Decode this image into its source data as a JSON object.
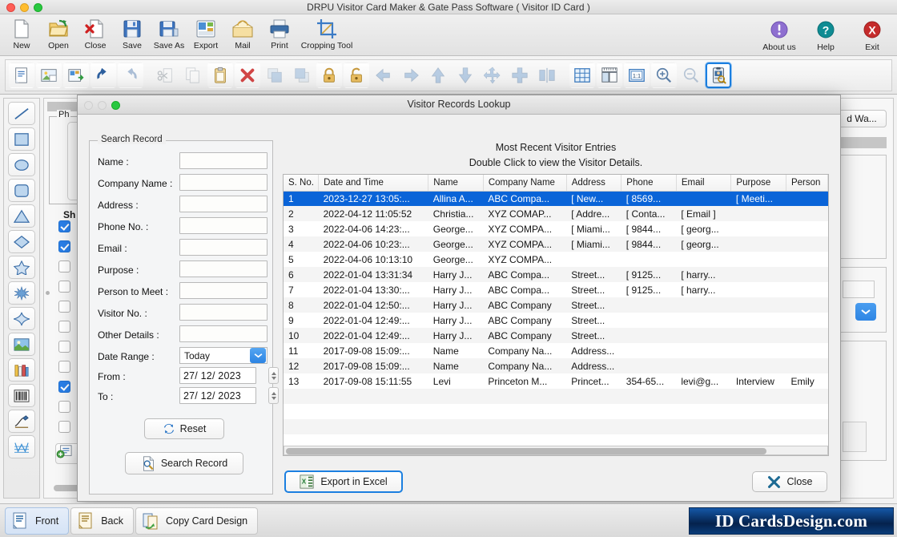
{
  "window": {
    "title": "DRPU Visitor Card Maker & Gate Pass Software ( Visitor ID Card )"
  },
  "toolbar_main": {
    "items": [
      {
        "label": "New",
        "icon": "new-document-icon"
      },
      {
        "label": "Open",
        "icon": "open-folder-icon"
      },
      {
        "label": "Close",
        "icon": "close-document-icon"
      },
      {
        "label": "Save",
        "icon": "floppy-save-icon"
      },
      {
        "label": "Save As",
        "icon": "floppy-save-as-icon"
      },
      {
        "label": "Export",
        "icon": "export-icon"
      },
      {
        "label": "Mail",
        "icon": "mail-envelope-icon"
      },
      {
        "label": "Print",
        "icon": "printer-icon"
      },
      {
        "label": "Cropping Tool",
        "icon": "crop-icon"
      }
    ],
    "right_items": [
      {
        "label": "About us",
        "icon": "info-circle-icon",
        "color": "#8e6fd0"
      },
      {
        "label": "Help",
        "icon": "question-circle-icon",
        "color": "#0f8c93"
      },
      {
        "label": "Exit",
        "icon": "exit-x-circle-icon",
        "color": "#c52b2b"
      }
    ]
  },
  "toolbar_icons": {
    "buttons": [
      {
        "name": "new-card-icon",
        "enabled": true,
        "selected": false
      },
      {
        "name": "add-image-icon",
        "enabled": true,
        "selected": false
      },
      {
        "name": "export-image-icon",
        "enabled": true,
        "selected": false
      },
      {
        "name": "undo-icon",
        "enabled": true,
        "selected": false
      },
      {
        "name": "redo-icon",
        "enabled": false,
        "selected": false
      },
      {
        "name": "cut-scissors-icon",
        "enabled": false,
        "selected": false
      },
      {
        "name": "copy-icon",
        "enabled": false,
        "selected": false
      },
      {
        "name": "paste-clipboard-icon",
        "enabled": true,
        "selected": false
      },
      {
        "name": "delete-x-icon",
        "enabled": true,
        "selected": false
      },
      {
        "name": "bring-front-icon",
        "enabled": false,
        "selected": false
      },
      {
        "name": "send-back-icon",
        "enabled": false,
        "selected": false
      },
      {
        "name": "lock-icon",
        "enabled": true,
        "selected": false
      },
      {
        "name": "unlock-icon",
        "enabled": true,
        "selected": false
      },
      {
        "name": "arrow-left-icon",
        "enabled": false,
        "selected": false
      },
      {
        "name": "arrow-right-icon",
        "enabled": false,
        "selected": false
      },
      {
        "name": "arrow-up-icon",
        "enabled": false,
        "selected": false
      },
      {
        "name": "arrow-down-icon",
        "enabled": false,
        "selected": false
      },
      {
        "name": "align-center-icon",
        "enabled": false,
        "selected": false
      },
      {
        "name": "align-horizontal-icon",
        "enabled": false,
        "selected": false
      },
      {
        "name": "align-vertical-icon",
        "enabled": false,
        "selected": false
      },
      {
        "name": "grid-icon",
        "enabled": true,
        "selected": false
      },
      {
        "name": "ruler-icon",
        "enabled": true,
        "selected": false
      },
      {
        "name": "actual-size-1-1-icon",
        "enabled": true,
        "selected": false
      },
      {
        "name": "zoom-in-icon",
        "enabled": true,
        "selected": false
      },
      {
        "name": "zoom-out-icon",
        "enabled": false,
        "selected": false
      },
      {
        "name": "visitor-records-lookup-icon",
        "enabled": true,
        "selected": true
      }
    ],
    "zoom_label": "1:1"
  },
  "left_tools": {
    "items": [
      {
        "name": "line-tool"
      },
      {
        "name": "rectangle-tool"
      },
      {
        "name": "ellipse-tool"
      },
      {
        "name": "rounded-rectangle-tool"
      },
      {
        "name": "triangle-tool"
      },
      {
        "name": "diamond-tool"
      },
      {
        "name": "star-tool"
      },
      {
        "name": "starburst-tool"
      },
      {
        "name": "four-point-star-tool"
      },
      {
        "name": "image-tool"
      },
      {
        "name": "library-tool"
      },
      {
        "name": "barcode-tool"
      },
      {
        "name": "signature-tool"
      },
      {
        "name": "watermark-tool"
      }
    ]
  },
  "workspace": {
    "photo_label": "Ph",
    "shape_label": "Sh",
    "watermark_button": "d Wa...",
    "checks": [
      true,
      true,
      false,
      false,
      false,
      false,
      false,
      false,
      true,
      false,
      false
    ]
  },
  "dialog": {
    "title": "Visitor Records Lookup",
    "search_group": {
      "legend": "Search Record",
      "fields": [
        {
          "label": "Name :",
          "value": "",
          "name": "name-field"
        },
        {
          "label": "Company Name :",
          "value": "",
          "name": "company-name-field"
        },
        {
          "label": "Address :",
          "value": "",
          "name": "address-field"
        },
        {
          "label": "Phone No. :",
          "value": "",
          "name": "phone-field"
        },
        {
          "label": "Email :",
          "value": "",
          "name": "email-field"
        },
        {
          "label": "Purpose :",
          "value": "",
          "name": "purpose-field"
        },
        {
          "label": "Person to Meet :",
          "value": "",
          "name": "person-to-meet-field"
        },
        {
          "label": "Visitor No. :",
          "value": "",
          "name": "visitor-no-field"
        },
        {
          "label": "Other Details :",
          "value": "",
          "name": "other-details-field"
        }
      ],
      "date_range_label": "Date Range :",
      "date_range_value": "Today",
      "from_label": "From :",
      "from_value": "27/ 12/ 2023",
      "to_label": "To :",
      "to_value": "27/ 12/ 2023",
      "reset_button": "Reset",
      "search_button": "Search Record"
    },
    "records": {
      "heading_line1": "Most Recent Visitor Entries",
      "heading_line2": "Double Click to view the Visitor Details.",
      "columns": [
        "S. No.",
        "Date and Time",
        "Name",
        "Company Name",
        "Address",
        "Phone",
        "Email",
        "Purpose",
        "Person"
      ],
      "rows": [
        {
          "sno": "1",
          "datetime": "2023-12-27 13:05:...",
          "name": "Allina A...",
          "company": "ABC Compa...",
          "address": "[ New...",
          "phone": "[ 8569...",
          "email": "",
          "purpose": "[ Meeti...",
          "person": "",
          "selected": true
        },
        {
          "sno": "2",
          "datetime": "2022-04-12 11:05:52",
          "name": "Christia...",
          "company": "XYZ COMAP...",
          "address": "[ Addre...",
          "phone": "[ Conta...",
          "email": "[ Email ]",
          "purpose": "",
          "person": "",
          "selected": false
        },
        {
          "sno": "3",
          "datetime": "2022-04-06 14:23:...",
          "name": "George...",
          "company": "XYZ COMPA...",
          "address": "[ Miami...",
          "phone": "[ 9844...",
          "email": "[ georg...",
          "purpose": "",
          "person": "",
          "selected": false
        },
        {
          "sno": "4",
          "datetime": "2022-04-06 10:23:...",
          "name": "George...",
          "company": "XYZ COMPA...",
          "address": "[ Miami...",
          "phone": "[ 9844...",
          "email": "[ georg...",
          "purpose": "",
          "person": "",
          "selected": false
        },
        {
          "sno": "5",
          "datetime": "2022-04-06 10:13:10",
          "name": "George...",
          "company": "XYZ COMPA...",
          "address": "",
          "phone": "",
          "email": "",
          "purpose": "",
          "person": "",
          "selected": false
        },
        {
          "sno": "6",
          "datetime": "2022-01-04 13:31:34",
          "name": "Harry J...",
          "company": "ABC Compa...",
          "address": "Street...",
          "phone": "[ 9125...",
          "email": "[ harry...",
          "purpose": "",
          "person": "",
          "selected": false
        },
        {
          "sno": "7",
          "datetime": "2022-01-04 13:30:...",
          "name": "Harry J...",
          "company": "ABC Compa...",
          "address": "Street...",
          "phone": "[ 9125...",
          "email": "[ harry...",
          "purpose": "",
          "person": "",
          "selected": false
        },
        {
          "sno": "8",
          "datetime": "2022-01-04 12:50:...",
          "name": "Harry J...",
          "company": "ABC Company",
          "address": "Street...",
          "phone": "",
          "email": "",
          "purpose": "",
          "person": "",
          "selected": false
        },
        {
          "sno": "9",
          "datetime": "2022-01-04 12:49:...",
          "name": "Harry J...",
          "company": "ABC Company",
          "address": "Street...",
          "phone": "",
          "email": "",
          "purpose": "",
          "person": "",
          "selected": false
        },
        {
          "sno": "10",
          "datetime": "2022-01-04 12:49:...",
          "name": "Harry J...",
          "company": "ABC Company",
          "address": "Street...",
          "phone": "",
          "email": "",
          "purpose": "",
          "person": "",
          "selected": false
        },
        {
          "sno": "11",
          "datetime": "2017-09-08 15:09:...",
          "name": "Name",
          "company": "Company Na...",
          "address": "Address...",
          "phone": "",
          "email": "",
          "purpose": "",
          "person": "",
          "selected": false
        },
        {
          "sno": "12",
          "datetime": "2017-09-08 15:09:...",
          "name": "Name",
          "company": "Company Na...",
          "address": "Address...",
          "phone": "",
          "email": "",
          "purpose": "",
          "person": "",
          "selected": false
        },
        {
          "sno": "13",
          "datetime": "2017-09-08 15:11:55",
          "name": "Levi",
          "company": "Princeton M...",
          "address": "Princet...",
          "phone": "354-65...",
          "email": "levi@g...",
          "purpose": "Interview",
          "person": "Emily",
          "selected": false
        }
      ]
    },
    "export_button": "Export  in Excel",
    "close_button": "Close"
  },
  "bottom_bar": {
    "buttons": [
      {
        "label": "Front",
        "icon": "card-front-icon",
        "active": true
      },
      {
        "label": "Back",
        "icon": "card-back-icon",
        "active": false
      },
      {
        "label": "Copy Card Design",
        "icon": "copy-card-icon",
        "active": false
      }
    ],
    "logo_text": "ID CardsDesign.com"
  },
  "colors": {
    "accent_blue": "#1b7fe0",
    "selection_blue": "#0a64d8",
    "logo_bg": "#05224d"
  }
}
